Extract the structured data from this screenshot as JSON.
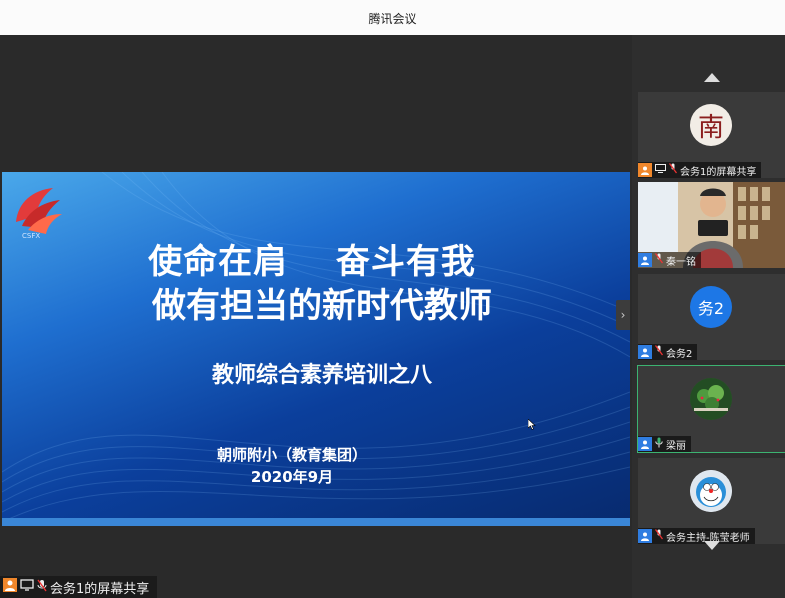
{
  "window": {
    "title": "腾讯会议"
  },
  "slide": {
    "line1": "使命在肩　 奋斗有我",
    "line2": "做有担当的新时代教师",
    "subtitle": "教师综合素养培训之八",
    "org": "朝师附小（教育集团）",
    "date": "2020年9月",
    "logo_text": "CSFX"
  },
  "share_badge": {
    "label": "会务1的屏幕共享"
  },
  "participants": [
    {
      "name": "会务1的屏幕共享",
      "avatar_char": "南",
      "badge_color": "orange",
      "mic": "muted",
      "screen_share": true
    },
    {
      "name": "秦一铭",
      "video": true,
      "mic": "muted"
    },
    {
      "name": "会务2",
      "avatar_char": "务2",
      "mic": "muted"
    },
    {
      "name": "梁丽",
      "mic": "active",
      "active_speaker": true
    },
    {
      "name": "会务主持-陈莹老师",
      "mic": "muted"
    }
  ],
  "colors": {
    "accent_blue": "#1d77e6",
    "active_green": "#3cb371",
    "orange": "#f0872b"
  }
}
